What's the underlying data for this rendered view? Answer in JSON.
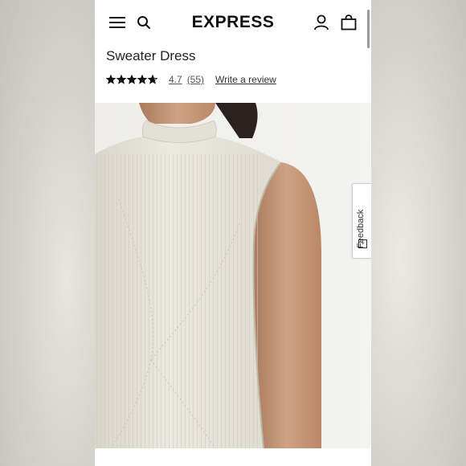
{
  "header": {
    "logo": "EXPRESS",
    "menu_icon": "hamburger-menu-icon",
    "search_icon": "search-icon",
    "account_icon": "user-icon",
    "bag_icon": "shopping-bag-icon"
  },
  "product": {
    "title": "Sweater Dress",
    "rating": {
      "stars": 4.7,
      "value": "4.7",
      "count": "(55)"
    },
    "write_review": "Write a review",
    "image_alt_icon": "product-photo"
  },
  "feedback": {
    "label": "Feedback"
  },
  "colors": {
    "text": "#222222",
    "star": "#111111",
    "link": "#555555",
    "background": "#ffffff",
    "sweater": "#e9e6dd",
    "skin": "#c99a7c"
  }
}
